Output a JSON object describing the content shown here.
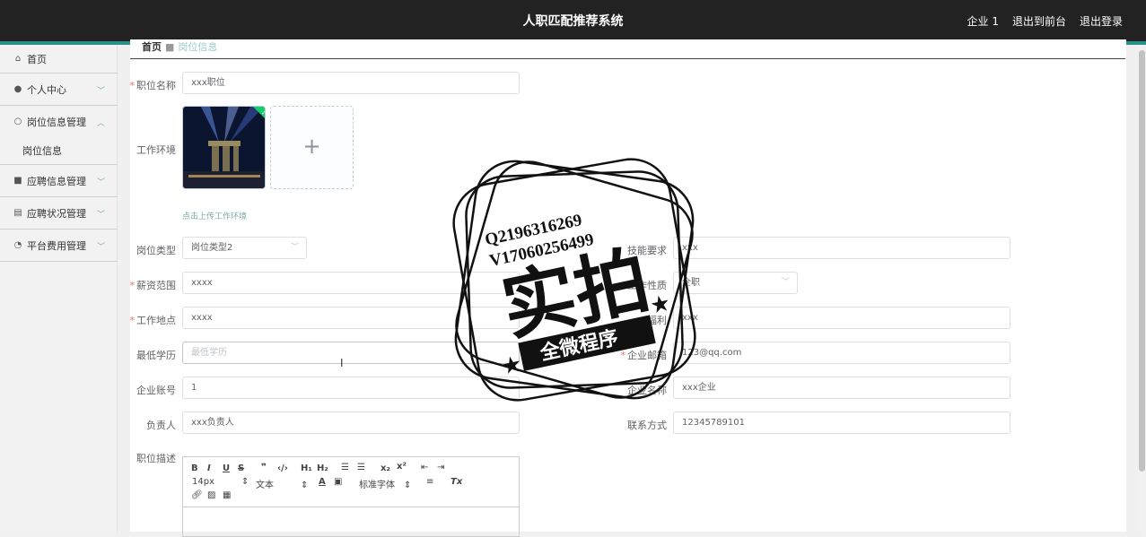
{
  "header": {
    "title": "人职匹配推荐系统",
    "user": "企业 1",
    "back_front": "退出到前台",
    "logout": "退出登录"
  },
  "sidebar": {
    "items": [
      {
        "label": "首页",
        "icon": "home-icon"
      },
      {
        "label": "个人中心",
        "icon": "user-icon"
      },
      {
        "label": "岗位信息管理",
        "icon": "power-icon"
      },
      {
        "label": "岗位信息"
      },
      {
        "label": "应聘信息管理",
        "icon": "checkbox-icon"
      },
      {
        "label": "应聘状况管理",
        "icon": "clipboard-icon"
      },
      {
        "label": "平台费用管理",
        "icon": "gauge-icon"
      }
    ]
  },
  "breadcrumb": {
    "home": "首页",
    "current": "岗位信息"
  },
  "form": {
    "job_name": {
      "label": "职位名称",
      "value": "xxx职位"
    },
    "work_env": {
      "label": "工作环境",
      "tip": "点击上传工作环境"
    },
    "job_type": {
      "label": "岗位类型",
      "value": "岗位类型2"
    },
    "skill_req": {
      "label": "技能要求",
      "value": "xxx"
    },
    "salary": {
      "label": "薪资范围",
      "value": "xxxx"
    },
    "job_nature": {
      "label": "工作性质",
      "value": "全职"
    },
    "location": {
      "label": "工作地点",
      "value": "xxxx"
    },
    "benefits": {
      "label": "福利",
      "value": "xxx"
    },
    "education": {
      "label": "最低学历",
      "placeholder": "最低学历"
    },
    "email": {
      "label": "企业邮箱",
      "value": "123@qq.com"
    },
    "account": {
      "label": "企业账号",
      "value": "1"
    },
    "company": {
      "label": "企业名称",
      "value": "xxx企业"
    },
    "contact_person": {
      "label": "负责人",
      "value": "xxx负责人"
    },
    "phone": {
      "label": "联系方式",
      "value": "12345789101"
    },
    "description": {
      "label": "职位描述"
    }
  },
  "editor": {
    "font_size": "14px",
    "text_style": "文本",
    "font_family": "标准字体"
  },
  "watermark": {
    "line1": "Q2196316269",
    "line2": "V17060256499",
    "main": "实拍",
    "banner": "全微程序"
  },
  "colors": {
    "accent": "#2b8f8a",
    "required": "#f56c6c",
    "topbar": "#222222"
  }
}
